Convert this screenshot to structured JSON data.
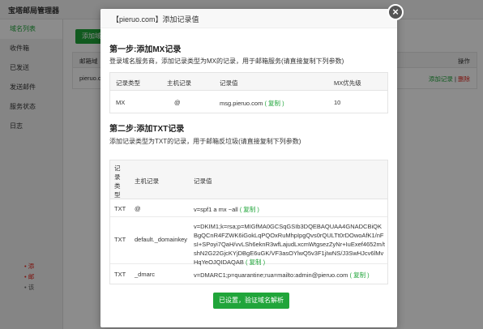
{
  "app": {
    "title": "宝塔邮局管理器",
    "sidebar": [
      {
        "label": "域名列表",
        "active": true
      },
      {
        "label": "收件箱",
        "active": false
      },
      {
        "label": "已发送",
        "active": false
      },
      {
        "label": "发送邮件",
        "active": false
      },
      {
        "label": "服务状态",
        "active": false
      },
      {
        "label": "日志",
        "active": false
      }
    ],
    "add_domain_button": "添加域",
    "table_header_domain": "邮箱域",
    "table_header_ops": "操作",
    "row_domain": "pieruo.c",
    "row_add_record": "添加记录",
    "row_separator": "|",
    "row_delete": "删除",
    "tips": [
      "添",
      "邮",
      "该"
    ]
  },
  "modal": {
    "title": "【pieruo.com】添加记录值",
    "close_symbol": "×",
    "step1": {
      "title": "第一步:添加MX记录",
      "desc": "登录域名服务商，添加记录类型为MX的记录，用于邮箱服务(请直接复制下列参数)",
      "headers": [
        "记录类型",
        "主机记录",
        "记录值",
        "MX优先级"
      ],
      "row": {
        "type": "MX",
        "host": "@",
        "value": "msg.pieruo.com",
        "copy": "( 复制 )",
        "priority": "10"
      }
    },
    "step2": {
      "title": "第二步:添加TXT记录",
      "desc": "添加记录类型为TXT的记录，用于邮箱反垃圾(请直接复制下列参数)",
      "headers": [
        "记录类型",
        "主机记录",
        "记录值"
      ],
      "rows": [
        {
          "type": "TXT",
          "host": "@",
          "value": "v=spf1 a mx ~all",
          "copy": "( 复制 )"
        },
        {
          "type": "TXT",
          "host": "default._domainkey",
          "value": "v=DKIM1;k=rsa;p=MIGfMA0GCSqGSIb3DQEBAQUAA4GNADCBiQKBgQCnR4FZWK6iGokLqPQOxRuMhpIpgQvs0rQULTt0rDOwoAfK1/nFsI+SPoyi7QaH/vvLSh6eknR3wfLajudLxcmWtgsezZyNr+IuExef4652m/tshN2G22GjcKYjDBgE6uGK/VF3asOYlwQ5v3F1jIwNS/J3SwHJcv6lMvHqYeOJQIDAQAB",
          "copy": "( 复制 )"
        },
        {
          "type": "TXT",
          "host": "_dmarc",
          "value": "v=DMARC1;p=quarantine;rua=mailto:admin@pieruo.com",
          "copy": "( 复制 )"
        }
      ]
    },
    "confirm_button": "已设置，验证域名解析"
  },
  "colors": {
    "accent": "#20a53a",
    "danger": "#e2231a",
    "overlay": "rgba(0,0,0,0.45)"
  }
}
